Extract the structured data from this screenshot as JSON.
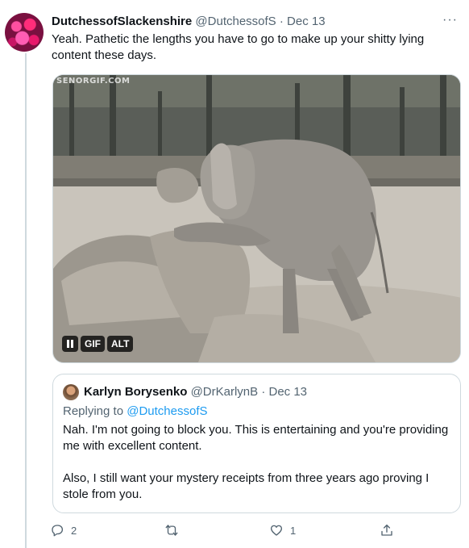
{
  "tweet": {
    "display_name": "DutchessofSlackenshire",
    "handle": "@DutchessofS",
    "separator": "·",
    "date": "Dec 13",
    "more_label": "···",
    "text": "Yeah.  Pathetic the lengths you have to go to make up your shitty lying content these days."
  },
  "media": {
    "watermark": "SENORGIF.COM",
    "pause_icon": "pause-icon",
    "gif_label": "GIF",
    "alt_label": "ALT"
  },
  "quote": {
    "display_name": "Karlyn Borysenko",
    "handle": "@DrKarlynB",
    "separator": "·",
    "date": "Dec 13",
    "replying_prefix": "Replying to ",
    "replying_to": "@DutchessofS",
    "paragraph_1": "Nah. I'm not going to block you. This is entertaining and you're providing me with excellent content.",
    "paragraph_2": "Also, I still want your mystery receipts from three years ago proving I stole from you."
  },
  "actions": {
    "reply_count": "2",
    "retweet_count": "",
    "like_count": "1",
    "share_count": ""
  },
  "colors": {
    "link": "#1d9bf0",
    "secondary_text": "#536471",
    "border": "#cfd9de"
  }
}
